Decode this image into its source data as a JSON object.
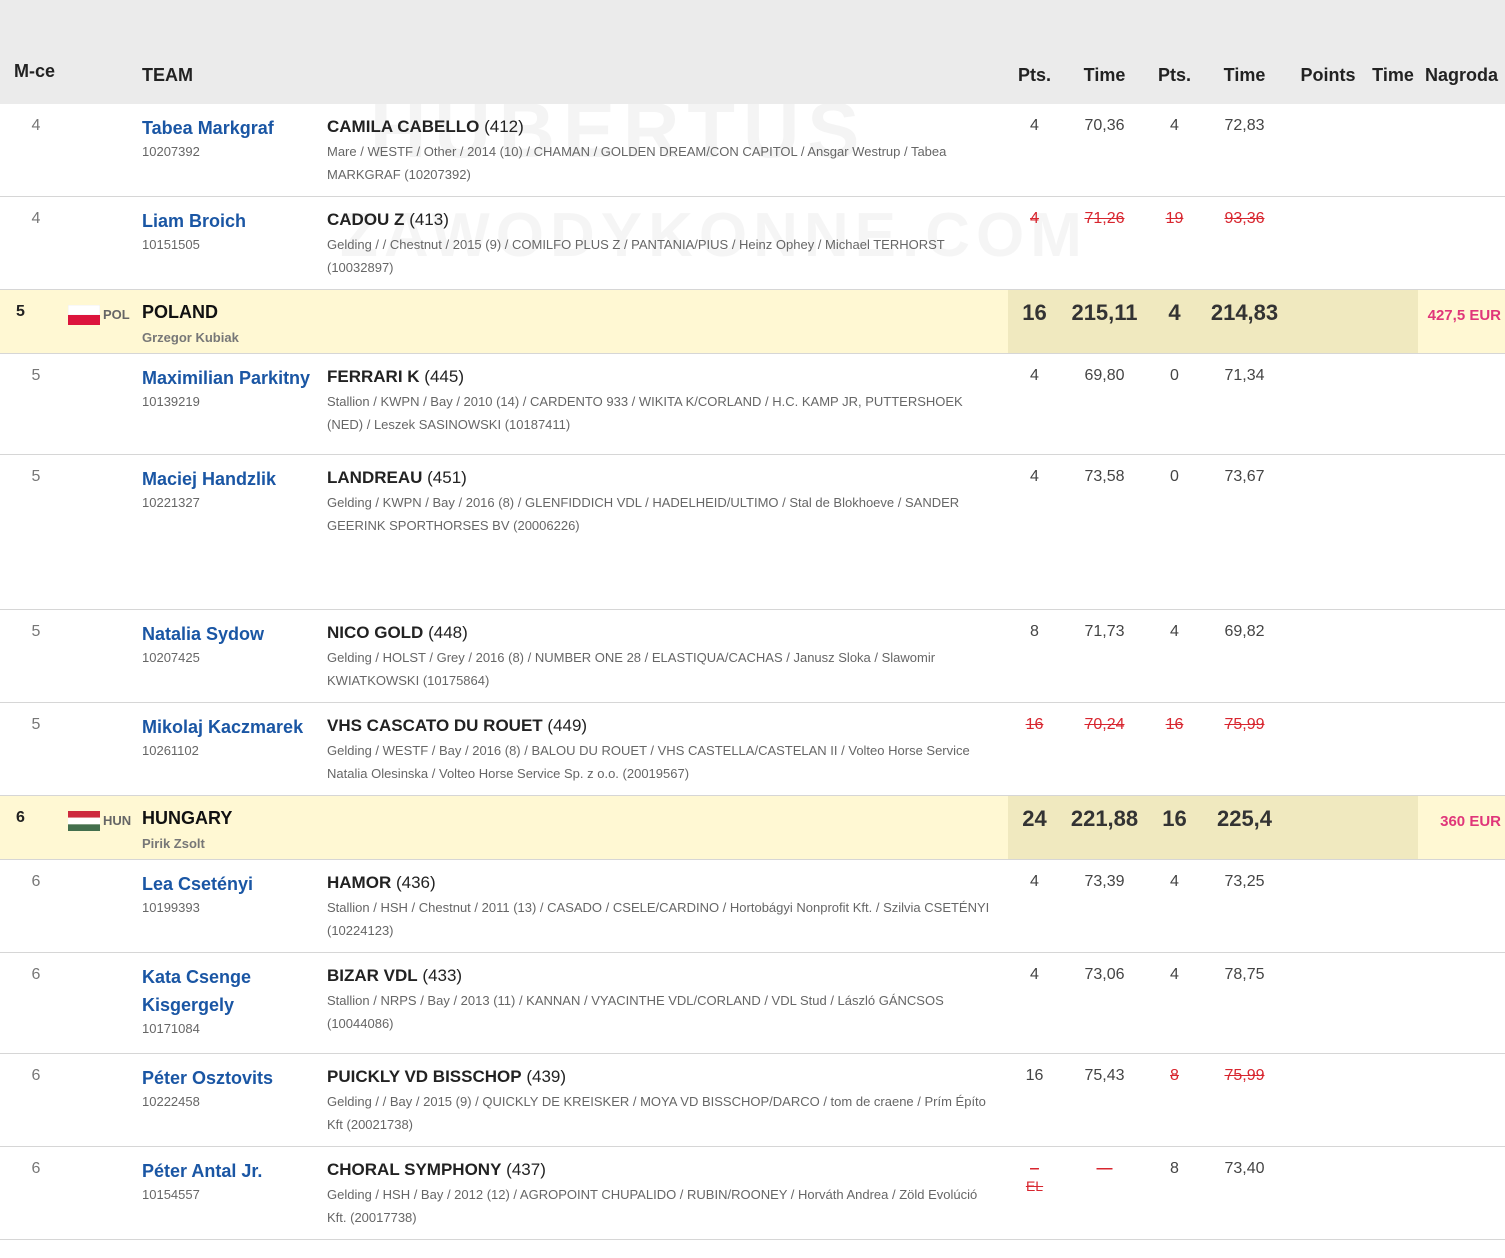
{
  "watermark": {
    "line1": "HUBERTUS",
    "line2": "ZAWODYKONNE.COM"
  },
  "colors": {
    "link": "#1a56a4",
    "strike": "#d8262f",
    "prize": "#e0367a",
    "team_bg": "#fff8d3",
    "total_bg": "#f0e9bf",
    "header_bg": "#ebebeb"
  },
  "header": {
    "mce": "M-ce",
    "team": "TEAM",
    "pts1": "Pts.",
    "time1": "Time",
    "pts2": "Pts.",
    "time2": "Time",
    "points": "Points",
    "time3": "Time",
    "prize": "Nagroda"
  },
  "rows": [
    {
      "place": "4",
      "rider": "Tabea Markgraf",
      "rider_id": "10207392",
      "horse": "CAMILA CABELLO",
      "horse_no": "(412)",
      "desc": "Mare / WESTF / Other / 2014 (10) / CHAMAN / GOLDEN DREAM/CON CAPITOL / Ansgar Westrup / Tabea MARKGRAF (10207392)",
      "pts1": "4",
      "time1": "70,36",
      "pts2": "4",
      "time2": "72,83"
    },
    {
      "place": "4",
      "rider": "Liam Broich",
      "rider_id": "10151505",
      "horse": "CADOU Z",
      "horse_no": "(413)",
      "desc": "Gelding / / Chestnut / 2015 (9) / COMILFO PLUS Z / PANTANIA/PIUS / Heinz Ophey / Michael TERHORST (10032897)",
      "pts1": "4",
      "time1": "71,26",
      "pts2": "19",
      "time2": "93,36"
    },
    {
      "team_place": "5",
      "flag": "poland",
      "code": "POL",
      "team": "POLAND",
      "chef": "Grzegor Kubiak",
      "pts1": "16",
      "time1": "215,11",
      "pts2": "4",
      "time2": "214,83",
      "prize": "427,5 EUR"
    },
    {
      "place": "5",
      "rider": "Maximilian Parkitny",
      "rider_id": "10139219",
      "horse": "FERRARI K",
      "horse_no": "(445)",
      "desc": "Stallion / KWPN / Bay / 2010 (14) / CARDENTO 933 / WIKITA K/CORLAND / H.C. KAMP JR, PUTTERSHOEK (NED) / Leszek SASINOWSKI (10187411)",
      "pts1": "4",
      "time1": "69,80",
      "pts2": "0",
      "time2": "71,34"
    },
    {
      "place": "5",
      "rider": "Maciej Handzlik",
      "rider_id": "10221327",
      "horse": "LANDREAU",
      "horse_no": "(451)",
      "desc": "Gelding / KWPN / Bay / 2016 (8) / GLENFIDDICH VDL / HADELHEID/ULTIMO / Stal de Blokhoeve / SANDER GEERINK SPORTHORSES BV (20006226)",
      "pts1": "4",
      "time1": "73,58",
      "pts2": "0",
      "time2": "73,67"
    },
    {
      "place": "5",
      "rider": "Natalia Sydow",
      "rider_id": "10207425",
      "horse": "NICO GOLD",
      "horse_no": "(448)",
      "desc": "Gelding / HOLST / Grey / 2016 (8) / NUMBER ONE 28 / ELASTIQUA/CACHAS / Janusz Sloka / Slawomir KWIATKOWSKI (10175864)",
      "pts1": "8",
      "time1": "71,73",
      "pts2": "4",
      "time2": "69,82"
    },
    {
      "place": "5",
      "rider": "Mikolaj Kaczmarek",
      "rider_id": "10261102",
      "horse": "VHS CASCATO DU ROUET",
      "horse_no": "(449)",
      "desc": "Gelding / WESTF / Bay / 2016 (8) / BALOU DU ROUET / VHS CASTELLA/CASTELAN II / Volteo Horse Service Natalia Olesinska / Volteo Horse Service Sp. z o.o. (20019567)",
      "pts1": "16",
      "time1": "70,24",
      "pts2": "16",
      "time2": "75,99"
    },
    {
      "team_place": "6",
      "flag": "hungary",
      "code": "HUN",
      "team": "HUNGARY",
      "chef": "Pirik Zsolt",
      "pts1": "24",
      "time1": "221,88",
      "pts2": "16",
      "time2": "225,4",
      "prize": "360 EUR"
    },
    {
      "place": "6",
      "rider": "Lea Csetényi",
      "rider_id": "10199393",
      "horse": "HAMOR",
      "horse_no": "(436)",
      "desc": "Stallion / HSH / Chestnut / 2011 (13) / CASADO / CSELE/CARDINO / Hortobágyi Nonprofit Kft. / Szilvia CSETÉNYI (10224123)",
      "pts1": "4",
      "time1": "73,39",
      "pts2": "4",
      "time2": "73,25"
    },
    {
      "place": "6",
      "rider": "Kata Csenge Kisgergely",
      "rider_id": "10171084",
      "horse": "BIZAR VDL",
      "horse_no": "(433)",
      "desc": "Stallion / NRPS / Bay / 2013 (11) / KANNAN / VYACINTHE VDL/CORLAND / VDL Stud / László GÁNCSOS (10044086)",
      "pts1": "4",
      "time1": "73,06",
      "pts2": "4",
      "time2": "78,75"
    },
    {
      "place": "6",
      "rider": "Péter Osztovits",
      "rider_id": "10222458",
      "horse": "PUICKLY VD BISSCHOP",
      "horse_no": "(439)",
      "desc": "Gelding / / Bay / 2015 (9) / QUICKLY DE KREISKER / MOYA VD BISSCHOP/DARCO / tom de craene / Prím Építo Kft (20021738)",
      "pts1": "16",
      "time1": "75,43",
      "pts2": "8",
      "time2": "75,99"
    },
    {
      "place": "6",
      "rider": "Péter Antal Jr.",
      "rider_id": "10154557",
      "horse": "CHORAL SYMPHONY",
      "horse_no": "(437)",
      "desc": "Gelding / HSH / Bay / 2012 (12) / AGROPOINT CHUPALIDO / RUBIN/ROONEY / Horváth Andrea / Zöld Evolúció Kft. (20017738)",
      "pts1": "–",
      "pts1_note": "EL",
      "time1": "—",
      "pts2": "8",
      "time2": "73,40"
    }
  ]
}
